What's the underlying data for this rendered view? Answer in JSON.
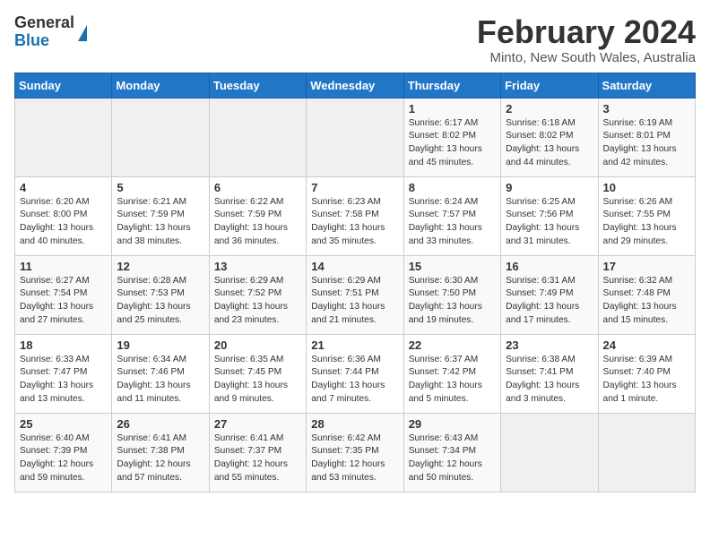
{
  "header": {
    "logo_line1": "General",
    "logo_line2": "Blue",
    "title": "February 2024",
    "subtitle": "Minto, New South Wales, Australia"
  },
  "columns": [
    "Sunday",
    "Monday",
    "Tuesday",
    "Wednesday",
    "Thursday",
    "Friday",
    "Saturday"
  ],
  "weeks": [
    [
      {
        "day": "",
        "info": ""
      },
      {
        "day": "",
        "info": ""
      },
      {
        "day": "",
        "info": ""
      },
      {
        "day": "",
        "info": ""
      },
      {
        "day": "1",
        "info": "Sunrise: 6:17 AM\nSunset: 8:02 PM\nDaylight: 13 hours\nand 45 minutes."
      },
      {
        "day": "2",
        "info": "Sunrise: 6:18 AM\nSunset: 8:02 PM\nDaylight: 13 hours\nand 44 minutes."
      },
      {
        "day": "3",
        "info": "Sunrise: 6:19 AM\nSunset: 8:01 PM\nDaylight: 13 hours\nand 42 minutes."
      }
    ],
    [
      {
        "day": "4",
        "info": "Sunrise: 6:20 AM\nSunset: 8:00 PM\nDaylight: 13 hours\nand 40 minutes."
      },
      {
        "day": "5",
        "info": "Sunrise: 6:21 AM\nSunset: 7:59 PM\nDaylight: 13 hours\nand 38 minutes."
      },
      {
        "day": "6",
        "info": "Sunrise: 6:22 AM\nSunset: 7:59 PM\nDaylight: 13 hours\nand 36 minutes."
      },
      {
        "day": "7",
        "info": "Sunrise: 6:23 AM\nSunset: 7:58 PM\nDaylight: 13 hours\nand 35 minutes."
      },
      {
        "day": "8",
        "info": "Sunrise: 6:24 AM\nSunset: 7:57 PM\nDaylight: 13 hours\nand 33 minutes."
      },
      {
        "day": "9",
        "info": "Sunrise: 6:25 AM\nSunset: 7:56 PM\nDaylight: 13 hours\nand 31 minutes."
      },
      {
        "day": "10",
        "info": "Sunrise: 6:26 AM\nSunset: 7:55 PM\nDaylight: 13 hours\nand 29 minutes."
      }
    ],
    [
      {
        "day": "11",
        "info": "Sunrise: 6:27 AM\nSunset: 7:54 PM\nDaylight: 13 hours\nand 27 minutes."
      },
      {
        "day": "12",
        "info": "Sunrise: 6:28 AM\nSunset: 7:53 PM\nDaylight: 13 hours\nand 25 minutes."
      },
      {
        "day": "13",
        "info": "Sunrise: 6:29 AM\nSunset: 7:52 PM\nDaylight: 13 hours\nand 23 minutes."
      },
      {
        "day": "14",
        "info": "Sunrise: 6:29 AM\nSunset: 7:51 PM\nDaylight: 13 hours\nand 21 minutes."
      },
      {
        "day": "15",
        "info": "Sunrise: 6:30 AM\nSunset: 7:50 PM\nDaylight: 13 hours\nand 19 minutes."
      },
      {
        "day": "16",
        "info": "Sunrise: 6:31 AM\nSunset: 7:49 PM\nDaylight: 13 hours\nand 17 minutes."
      },
      {
        "day": "17",
        "info": "Sunrise: 6:32 AM\nSunset: 7:48 PM\nDaylight: 13 hours\nand 15 minutes."
      }
    ],
    [
      {
        "day": "18",
        "info": "Sunrise: 6:33 AM\nSunset: 7:47 PM\nDaylight: 13 hours\nand 13 minutes."
      },
      {
        "day": "19",
        "info": "Sunrise: 6:34 AM\nSunset: 7:46 PM\nDaylight: 13 hours\nand 11 minutes."
      },
      {
        "day": "20",
        "info": "Sunrise: 6:35 AM\nSunset: 7:45 PM\nDaylight: 13 hours\nand 9 minutes."
      },
      {
        "day": "21",
        "info": "Sunrise: 6:36 AM\nSunset: 7:44 PM\nDaylight: 13 hours\nand 7 minutes."
      },
      {
        "day": "22",
        "info": "Sunrise: 6:37 AM\nSunset: 7:42 PM\nDaylight: 13 hours\nand 5 minutes."
      },
      {
        "day": "23",
        "info": "Sunrise: 6:38 AM\nSunset: 7:41 PM\nDaylight: 13 hours\nand 3 minutes."
      },
      {
        "day": "24",
        "info": "Sunrise: 6:39 AM\nSunset: 7:40 PM\nDaylight: 13 hours\nand 1 minute."
      }
    ],
    [
      {
        "day": "25",
        "info": "Sunrise: 6:40 AM\nSunset: 7:39 PM\nDaylight: 12 hours\nand 59 minutes."
      },
      {
        "day": "26",
        "info": "Sunrise: 6:41 AM\nSunset: 7:38 PM\nDaylight: 12 hours\nand 57 minutes."
      },
      {
        "day": "27",
        "info": "Sunrise: 6:41 AM\nSunset: 7:37 PM\nDaylight: 12 hours\nand 55 minutes."
      },
      {
        "day": "28",
        "info": "Sunrise: 6:42 AM\nSunset: 7:35 PM\nDaylight: 12 hours\nand 53 minutes."
      },
      {
        "day": "29",
        "info": "Sunrise: 6:43 AM\nSunset: 7:34 PM\nDaylight: 12 hours\nand 50 minutes."
      },
      {
        "day": "",
        "info": ""
      },
      {
        "day": "",
        "info": ""
      }
    ]
  ]
}
